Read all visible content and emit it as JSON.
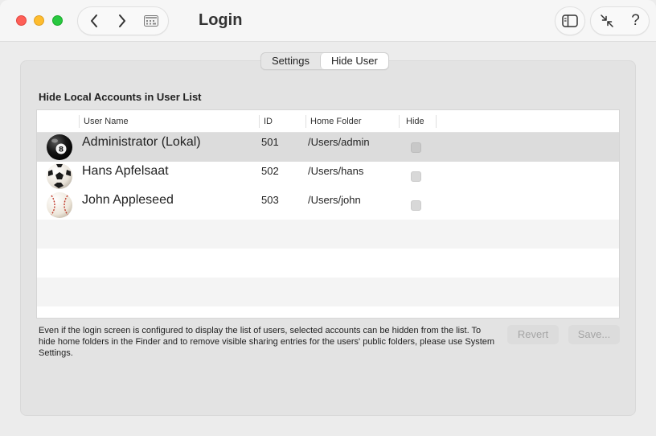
{
  "window": {
    "title": "Login"
  },
  "toolbar": {
    "back_icon": "chevron-left-icon",
    "forward_icon": "chevron-right-icon",
    "grid_icon": "app-grid-icon",
    "sidebar_icon": "sidebar-icon",
    "collapse_icon": "collapse-arrows-icon",
    "help_label": "?"
  },
  "tabs": [
    {
      "label": "Settings",
      "active": false
    },
    {
      "label": "Hide User",
      "active": true
    }
  ],
  "section": {
    "title": "Hide Local Accounts in User List"
  },
  "table": {
    "columns": [
      "User Name",
      "ID",
      "Home Folder",
      "Hide"
    ],
    "rows": [
      {
        "name": "Administrator (Lokal)",
        "id": "501",
        "home": "/Users/admin",
        "hide": false,
        "avatar": "eight-ball-icon",
        "selected": true
      },
      {
        "name": "Hans Apfelsaat",
        "id": "502",
        "home": "/Users/hans",
        "hide": false,
        "avatar": "soccer-ball-icon",
        "selected": false
      },
      {
        "name": "John Appleseed",
        "id": "503",
        "home": "/Users/john",
        "hide": false,
        "avatar": "baseball-icon",
        "selected": false
      }
    ]
  },
  "footer": {
    "note": "Even if the login screen is configured to display the list of users, selected accounts can be hidden from the list. To hide home folders in the Finder and to remove visible sharing entries for the users' public folders, please use System Settings.",
    "revert_label": "Revert",
    "save_label": "Save..."
  },
  "colors": {
    "close": "#fe5f57",
    "minimize": "#febc2e",
    "maximize": "#28c840",
    "selected_row": "#dcdcdc",
    "disabled_text": "#a5a5a5"
  }
}
